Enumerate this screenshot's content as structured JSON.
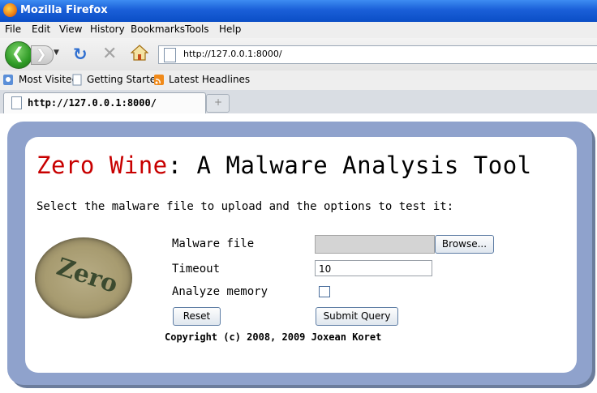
{
  "window": {
    "title": "Mozilla Firefox"
  },
  "menu": [
    "File",
    "Edit",
    "View",
    "History",
    "Bookmarks",
    "Tools",
    "Help"
  ],
  "address_bar": {
    "url": "http://127.0.0.1:8000/"
  },
  "bookmarks": [
    "Most Visited",
    "Getting Started",
    "Latest Headlines"
  ],
  "tabs": [
    {
      "label": "http://127.0.0.1:8000/"
    }
  ],
  "page": {
    "heading_red": "Zero Wine",
    "heading_rest": ": A Malware Analysis Tool",
    "subtitle": "Select the malware file to upload and the options to test it:",
    "logo_text": "Zero",
    "form": {
      "malware_file_label": "Malware file",
      "browse_label": "Browse...",
      "timeout_label": "Timeout",
      "timeout_value": "10",
      "analyze_memory_label": "Analyze memory",
      "analyze_memory_checked": false,
      "reset_label": "Reset",
      "submit_label": "Submit Query"
    },
    "copyright": "Copyright (c) 2008, 2009 Joxean Koret"
  },
  "colors": {
    "heading_accent": "#c80000",
    "panel_border": "#8fa2cc",
    "titlebar": "#1a5fd8"
  }
}
